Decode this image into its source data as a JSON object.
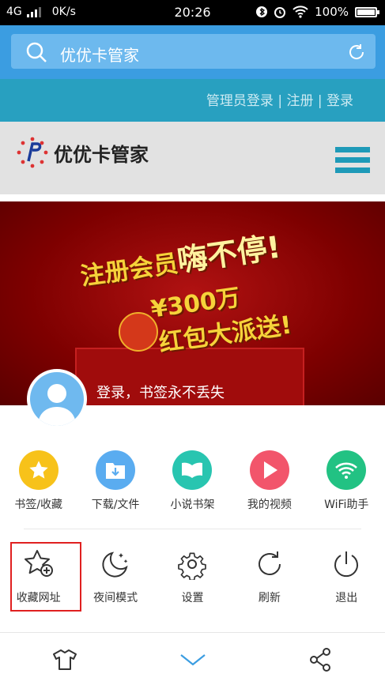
{
  "status": {
    "network": "4G",
    "speed": "0K/s",
    "time": "20:26",
    "battery": "100%"
  },
  "search": {
    "text": "优优卡管家"
  },
  "site": {
    "links": [
      "管理员登录",
      "注册",
      "登录"
    ],
    "name": "优优卡管家"
  },
  "banner": {
    "line1": "注册会员",
    "line1_emph": "嗨不停!",
    "line2": "¥300万",
    "line3": "红包大派送!"
  },
  "menu": {
    "login_tip": "登录，书签永不丢失",
    "row1": [
      {
        "label": "书签/收藏",
        "icon": "star-icon",
        "color": "#f7c21a"
      },
      {
        "label": "下载/文件",
        "icon": "download-folder-icon",
        "color": "#5aacf0"
      },
      {
        "label": "小说书架",
        "icon": "book-icon",
        "color": "#28c5b0"
      },
      {
        "label": "我的视频",
        "icon": "play-icon",
        "color": "#f2556b"
      },
      {
        "label": "WiFi助手",
        "icon": "wifi-icon",
        "color": "#22c283"
      }
    ],
    "row2": [
      {
        "label": "收藏网址",
        "icon": "star-add-icon"
      },
      {
        "label": "夜间模式",
        "icon": "moon-icon"
      },
      {
        "label": "设置",
        "icon": "gear-icon"
      },
      {
        "label": "刷新",
        "icon": "refresh-icon"
      },
      {
        "label": "退出",
        "icon": "power-icon"
      }
    ]
  },
  "colors": {
    "browser_blue": "#3b9de1",
    "teal": "#28a0c0",
    "highlight": "#e02020"
  }
}
